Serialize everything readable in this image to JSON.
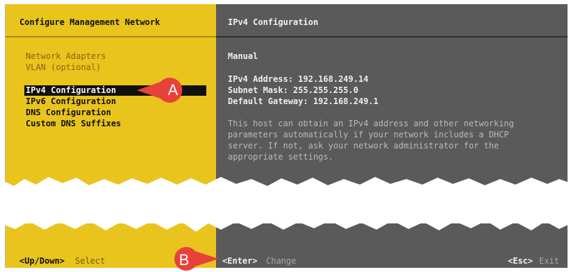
{
  "left_panel": {
    "title": "Configure Management Network",
    "menu": [
      {
        "label": "Network Adapters",
        "style": "dim"
      },
      {
        "label": "VLAN (optional)",
        "style": "dim"
      },
      {
        "label": "IPv4 Configuration",
        "style": "selected"
      },
      {
        "label": "IPv6 Configuration",
        "style": "bold"
      },
      {
        "label": "DNS Configuration",
        "style": "bold"
      },
      {
        "label": "Custom DNS Suffixes",
        "style": "bold"
      }
    ]
  },
  "right_panel": {
    "title": "IPv4 Configuration",
    "mode": "Manual",
    "ipv4_address": "IPv4 Address: 192.168.249.14",
    "subnet_mask": "Subnet Mask: 255.255.255.0",
    "default_gateway": "Default Gateway: 192.168.249.1",
    "help_lines": [
      "This host can obtain an IPv4 address and other networking",
      "parameters automatically if your network includes a DHCP",
      "server. If not, ask your network administrator for the",
      "appropriate settings."
    ]
  },
  "footer": {
    "updown_key": "<Up/Down>",
    "updown_action": "Select",
    "enter_key": "<Enter>",
    "enter_action": "Change",
    "esc_key": "<Esc>",
    "esc_action": "Exit"
  },
  "callouts": {
    "a": "A",
    "b": "B",
    "color": "#e8413a"
  },
  "colors": {
    "left_bg": "#e9c41d",
    "right_bg": "#5a5a5a",
    "selection_bg": "#111111"
  }
}
